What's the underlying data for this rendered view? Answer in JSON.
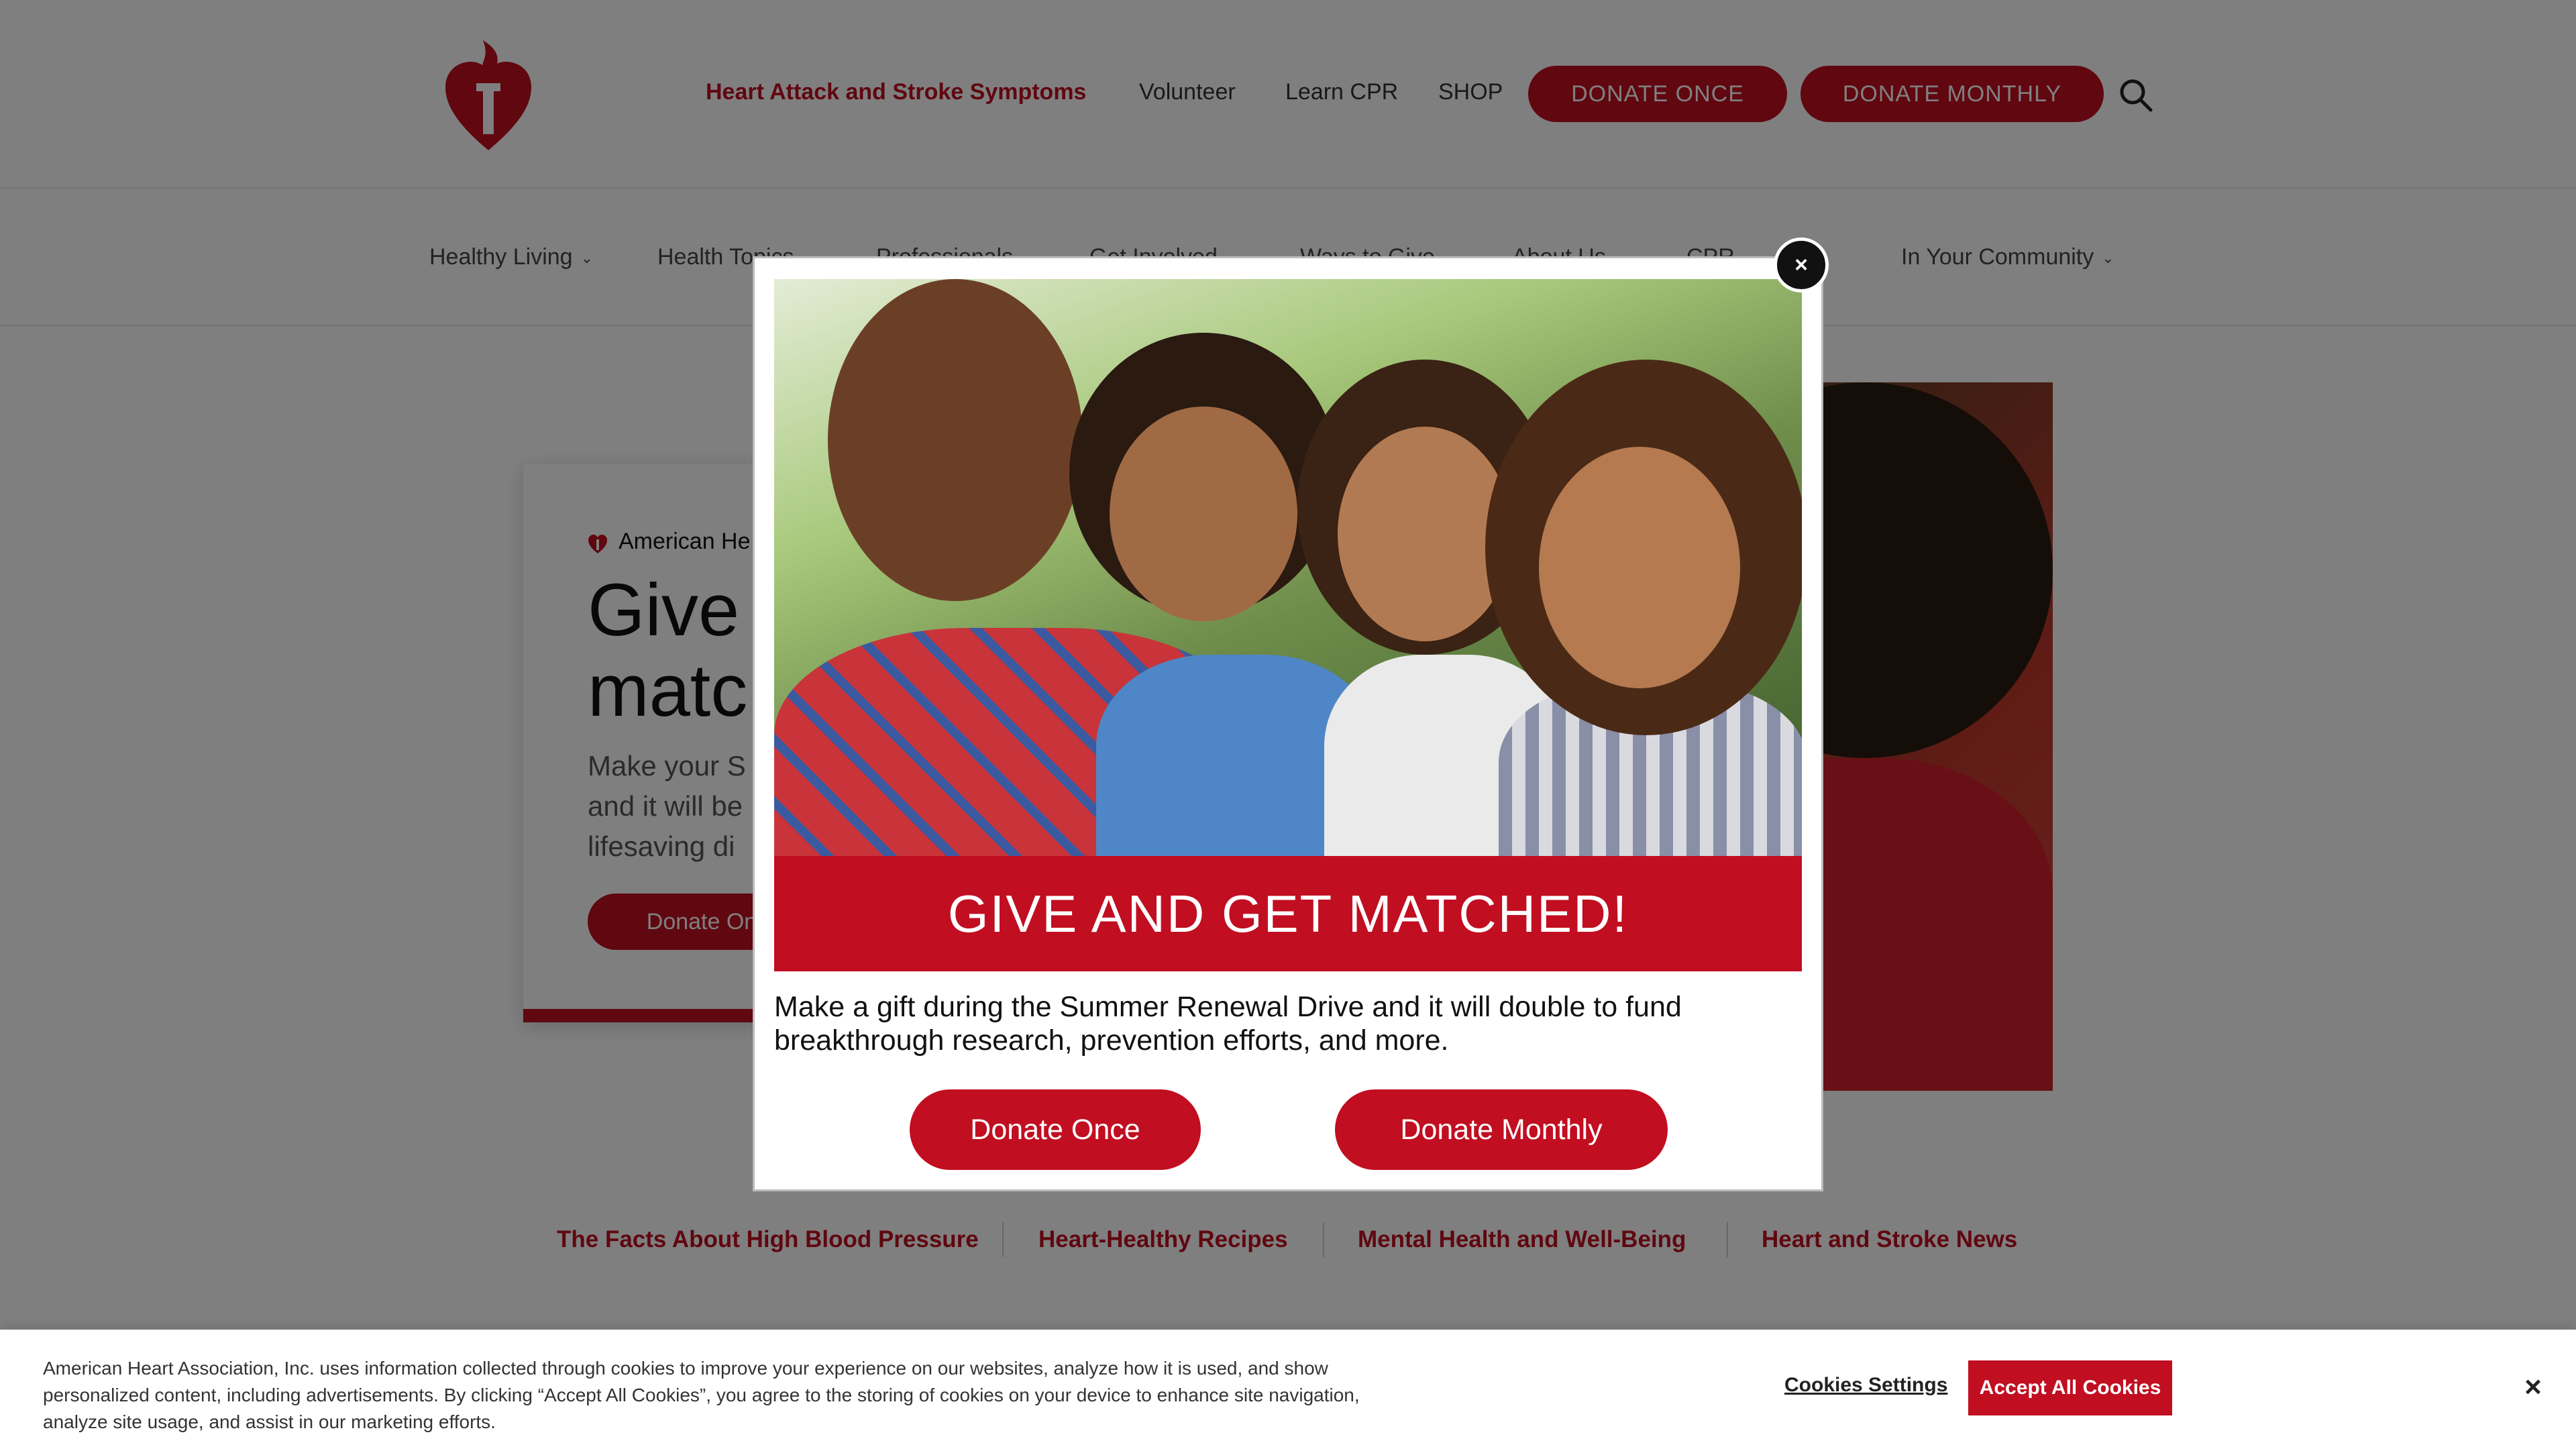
{
  "header": {
    "utility_links": [
      {
        "label": "Heart Attack and Stroke Symptoms",
        "highlight": true
      },
      {
        "label": "Volunteer"
      },
      {
        "label": "Learn CPR"
      },
      {
        "label": "SHOP"
      }
    ],
    "donate_once": "DONATE ONCE",
    "donate_monthly": "DONATE MONTHLY",
    "search_icon": "search-icon",
    "logo_icon": "heart-torch-logo"
  },
  "main_nav": [
    {
      "label": "Healthy Living"
    },
    {
      "label": "Health Topics"
    },
    {
      "label": "Professionals"
    },
    {
      "label": "Get Involved"
    },
    {
      "label": "Ways to Give"
    },
    {
      "label": "About Us"
    },
    {
      "label": "CPR"
    },
    {
      "label": "In Your Community"
    }
  ],
  "hero": {
    "brand": "American He",
    "title_line1": "Give",
    "title_line2": "matc",
    "body": "Make your S\nand it will be\nlifesaving di",
    "button": "Donate On"
  },
  "quick_links": [
    "The Facts About High Blood Pressure",
    "Heart-Healthy Recipes",
    "Mental Health and Well-Being",
    "Heart and Stroke News"
  ],
  "modal": {
    "close": "×",
    "banner": "GIVE AND GET MATCHED!",
    "text": "Make a gift during the Summer Renewal Drive and it will double to fund breakthrough research, prevention efforts, and more.",
    "donate_once": "Donate Once",
    "donate_monthly": "Donate Monthly"
  },
  "cookie": {
    "text": "American Heart Association, Inc. uses information collected through cookies to improve your experience on our websites, analyze how it is used, and show personalized content, including advertisements. By clicking “Accept All Cookies”, you agree to the storing of cookies on your device to enhance site navigation, analyze site usage, and assist in our marketing efforts.",
    "settings": "Cookies Settings",
    "accept": "Accept All Cookies",
    "close": "×"
  },
  "colors": {
    "brand_red": "#c10e21",
    "overlay": "rgba(0,0,0,0.5)"
  }
}
